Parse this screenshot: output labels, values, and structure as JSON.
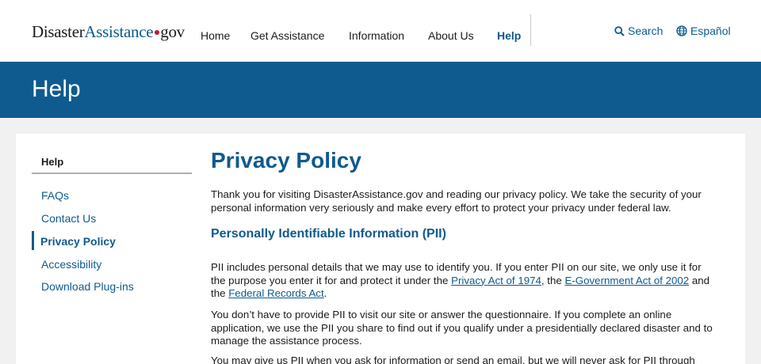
{
  "colors": {
    "brand": "#0f5a8e",
    "link": "#0f5a8e",
    "accent_red": "#c8102e",
    "banner": "#0f5a8e",
    "heading": "#0f5a8e"
  },
  "logo": {
    "part1": "Disaster",
    "part2": "Assistance",
    "part3": "gov"
  },
  "nav": {
    "home": "Home",
    "get_assistance": "Get Assistance",
    "information": "Information",
    "about_us": "About Us",
    "help": "Help",
    "active": "help"
  },
  "utility": {
    "search": {
      "label": "Search",
      "icon": "search-icon"
    },
    "language": {
      "label": "Español",
      "icon": "globe-icon"
    }
  },
  "banner": {
    "title": "Help"
  },
  "sidebar": {
    "heading": "Help",
    "items": [
      {
        "label": "FAQs"
      },
      {
        "label": "Contact Us"
      },
      {
        "label": "Privacy Policy",
        "active": true
      },
      {
        "label": "Accessibility"
      },
      {
        "label": "Download Plug-ins"
      }
    ]
  },
  "content": {
    "title": "Privacy Policy",
    "intro": {
      "line1": "Thank you for visiting DisasterAssistance.gov and reading our privacy policy. We take the security of your",
      "line2": "personal information very seriously and make every effort to protect your privacy under federal law."
    },
    "pii_heading": "Personally Identifiable Information (PII)",
    "p1": {
      "line1": "PII includes personal details that we may use to identify you. If you enter PII on our site, we only use it for",
      "line2_pre": "the purpose you enter it for and protect it under the ",
      "link_privacy_act": "Privacy Act of 1974",
      "line2_mid": ", the ",
      "link_egov_act": "E-Government Act of 2002",
      "line2_post": " and",
      "line3_pre": "the ",
      "link_records_act": "Federal Records Act",
      "line3_post": "."
    },
    "p2": {
      "line1": "You don’t have to provide PII to visit our site or answer the questionnaire. If you complete an online",
      "line2": "application, we use the PII you share to find out if you qualify under a presidentially declared disaster and to",
      "line3": "manage the assistance process."
    },
    "p3": {
      "line1": "You may give us PII when you ask for information or send an email, but we will never ask for PII through"
    }
  }
}
